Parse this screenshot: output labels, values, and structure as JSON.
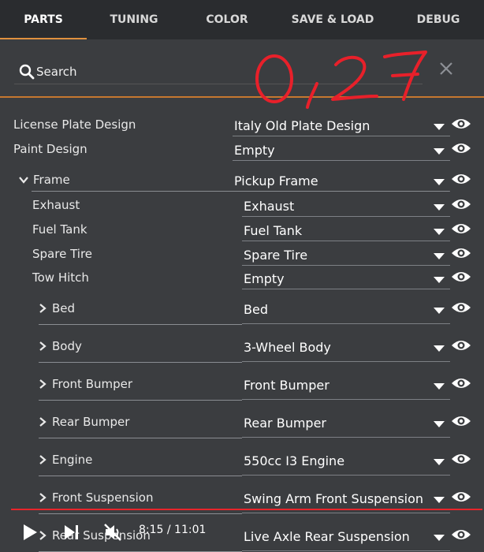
{
  "tabs": [
    "PARTS",
    "TUNING",
    "COLOR",
    "SAVE & LOAD",
    "DEBUG"
  ],
  "search": {
    "placeholder": "Search"
  },
  "annotation": "0,27",
  "rows": [
    {
      "label": "License Plate Design",
      "value": "Italy Old Plate Design",
      "expandable": false,
      "expanded": false,
      "depth": 0
    },
    {
      "label": "Paint Design",
      "value": "Empty",
      "expandable": false,
      "expanded": false,
      "depth": 0
    },
    {
      "label": "Frame",
      "value": "Pickup Frame",
      "expandable": true,
      "expanded": true,
      "depth": 0
    },
    {
      "label": "Exhaust",
      "value": "Exhaust",
      "expandable": false,
      "expanded": false,
      "depth": 1
    },
    {
      "label": "Fuel Tank",
      "value": "Fuel Tank",
      "expandable": false,
      "expanded": false,
      "depth": 1
    },
    {
      "label": "Spare Tire",
      "value": "Spare Tire",
      "expandable": false,
      "expanded": false,
      "depth": 1
    },
    {
      "label": "Tow Hitch",
      "value": "Empty",
      "expandable": false,
      "expanded": false,
      "depth": 1
    },
    {
      "label": "Bed",
      "value": "Bed",
      "expandable": true,
      "expanded": false,
      "depth": 1
    },
    {
      "label": "Body",
      "value": "3-Wheel Body",
      "expandable": true,
      "expanded": false,
      "depth": 1
    },
    {
      "label": "Front Bumper",
      "value": "Front Bumper",
      "expandable": true,
      "expanded": false,
      "depth": 1
    },
    {
      "label": "Rear Bumper",
      "value": "Rear Bumper",
      "expandable": true,
      "expanded": false,
      "depth": 1
    },
    {
      "label": "Engine",
      "value": "550cc I3 Engine",
      "expandable": true,
      "expanded": false,
      "depth": 1
    },
    {
      "label": "Front Suspension",
      "value": "Swing Arm Front Suspension",
      "expandable": true,
      "expanded": false,
      "depth": 1
    },
    {
      "label": "Rear Suspension",
      "value": "Live Axle Rear Suspension",
      "expandable": true,
      "expanded": false,
      "depth": 1
    }
  ],
  "player": {
    "time": "8:15 / 11:01"
  },
  "colors": {
    "accent": "#e0913f",
    "progress": "#e8252b",
    "annotation": "#e8202a",
    "background": "#3b3d40",
    "tabbar": "#2a2c2f"
  }
}
